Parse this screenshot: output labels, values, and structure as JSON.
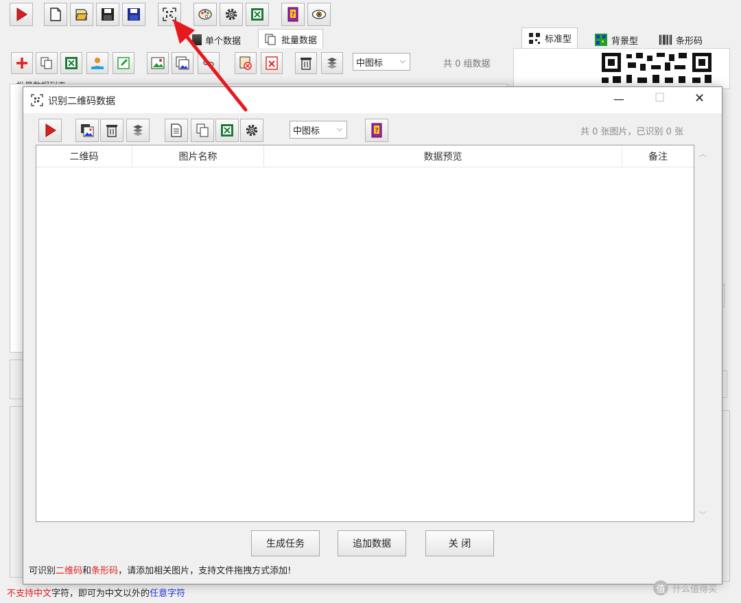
{
  "main_toolbar": {
    "buttons": [
      "run",
      "new",
      "open",
      "save",
      "save-as",
      "qr-scan",
      "palette",
      "settings",
      "excel",
      "help",
      "preview"
    ]
  },
  "left_tabs": [
    {
      "label": "单个数据"
    },
    {
      "label": "批量数据"
    }
  ],
  "right_tabs": [
    {
      "label": "标准型"
    },
    {
      "label": "背景型"
    },
    {
      "label": "条形码"
    }
  ],
  "batch_panel": {
    "view_combo": "中图标",
    "count_text": "共 0 组数据",
    "list_title": "批量数据列表"
  },
  "dialog": {
    "title": "识别二维码数据",
    "view_combo": "中图标",
    "status_text": "共 0 张图片，已识别 0 张",
    "columns": [
      "二维码",
      "图片名称",
      "数据预览",
      "备注"
    ],
    "buttons": {
      "generate": "生成任务",
      "append": "追加数据",
      "close": "关 闭"
    },
    "info": {
      "prefix": "可识别",
      "qr": "二维码",
      "and": "和",
      "barcode": "条形码",
      "suffix": "，请添加相关图片，支持文件拖拽方式添加!"
    },
    "window_controls": {
      "minimize": "—",
      "maximize": "☐",
      "close": "✕"
    }
  },
  "bottom_note": {
    "red_part": "不支持中文",
    "mid_part": "字符，即可为中文以外的",
    "blue_part": "任意字符"
  },
  "watermark": "什么值得买",
  "colors": {
    "red": "#e02020",
    "blue": "#1a34d6",
    "arrow": "#e8191e"
  }
}
